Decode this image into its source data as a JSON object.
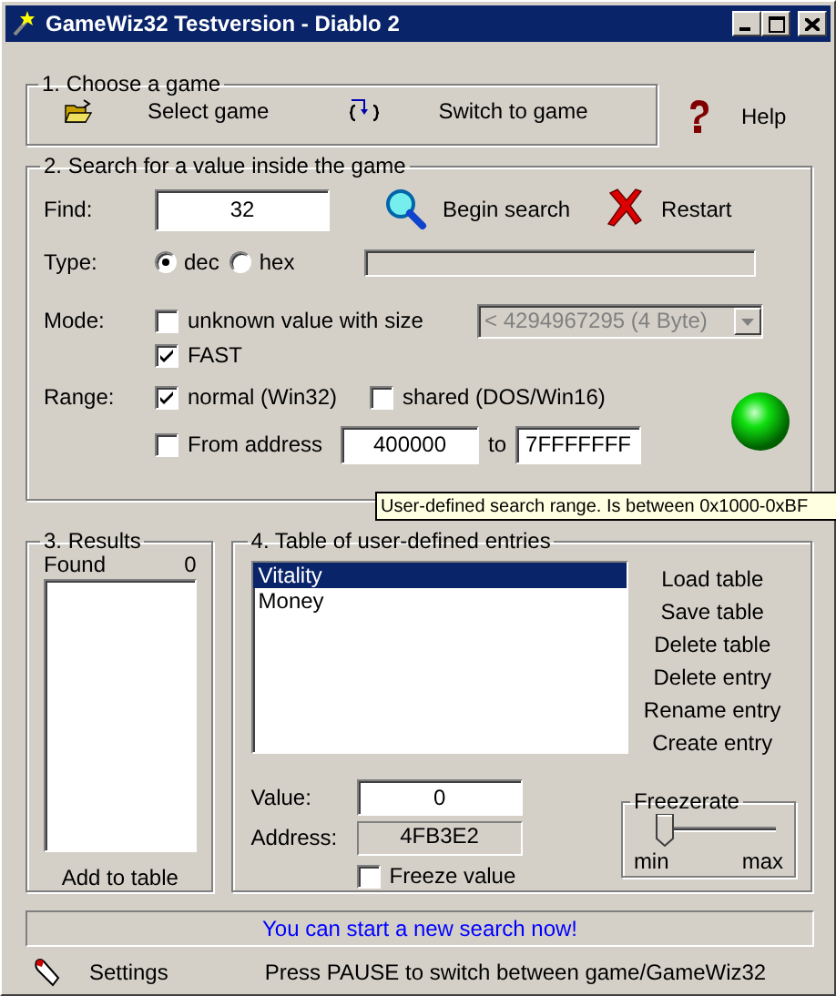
{
  "window": {
    "title": "GameWiz32 Testversion - Diablo 2"
  },
  "choose_game": {
    "title": "1. Choose a game",
    "buttons": [
      {
        "kind": "folder",
        "label": "Select game"
      },
      {
        "kind": "switch",
        "label": "Switch to game"
      }
    ],
    "help": "Help"
  },
  "search": {
    "title": "2. Search for a value inside the game",
    "find": {
      "label": "Find:",
      "value": "32"
    },
    "actions": [
      {
        "kind": "search",
        "label": "Begin search"
      },
      {
        "kind": "restart",
        "label": "Restart"
      }
    ],
    "type": {
      "label": "Type:",
      "options": [
        {
          "label": "dec",
          "selected": true
        },
        {
          "label": "hex",
          "selected": false
        }
      ]
    },
    "mode": {
      "label": "Mode:",
      "unknown": {
        "label": "unknown value with size",
        "checked": false
      },
      "size": {
        "value": "< 4294967295 (4 Byte)",
        "disabled": true
      },
      "fast": {
        "label": "FAST",
        "checked": true
      }
    },
    "range": {
      "label": "Range:",
      "normal": {
        "label": "normal (Win32)",
        "checked": true
      },
      "shared": {
        "label": "shared (DOS/Win16)",
        "checked": false
      },
      "from_address": {
        "label": "From address",
        "checked": false,
        "from": "400000",
        "to_label": "to",
        "to": "7FFFFFFF"
      }
    }
  },
  "tooltip": "User-defined search range. Is between 0x1000-0xBF",
  "results": {
    "title": "3. Results",
    "found_label": "Found",
    "found_count": "0",
    "add": "Add to table"
  },
  "table": {
    "title": "4. Table of user-defined entries",
    "entries": [
      {
        "label": "Vitality",
        "selected": true
      },
      {
        "label": "Money",
        "selected": false
      }
    ],
    "actions": [
      "Load table",
      "Save table",
      "Delete table",
      "Delete entry",
      "Rename entry",
      "Create entry"
    ],
    "value_label": "Value:",
    "value": "0",
    "address_label": "Address:",
    "address": "4FB3E2",
    "freeze": {
      "label": "Freeze value",
      "checked": false
    },
    "freezerate": {
      "title": "Freezerate",
      "level": 0,
      "min": "min",
      "max": "max"
    }
  },
  "status_message": "You can start a new search now!",
  "settings": "Settings",
  "hint": "Press PAUSE to switch between game/GameWiz32"
}
